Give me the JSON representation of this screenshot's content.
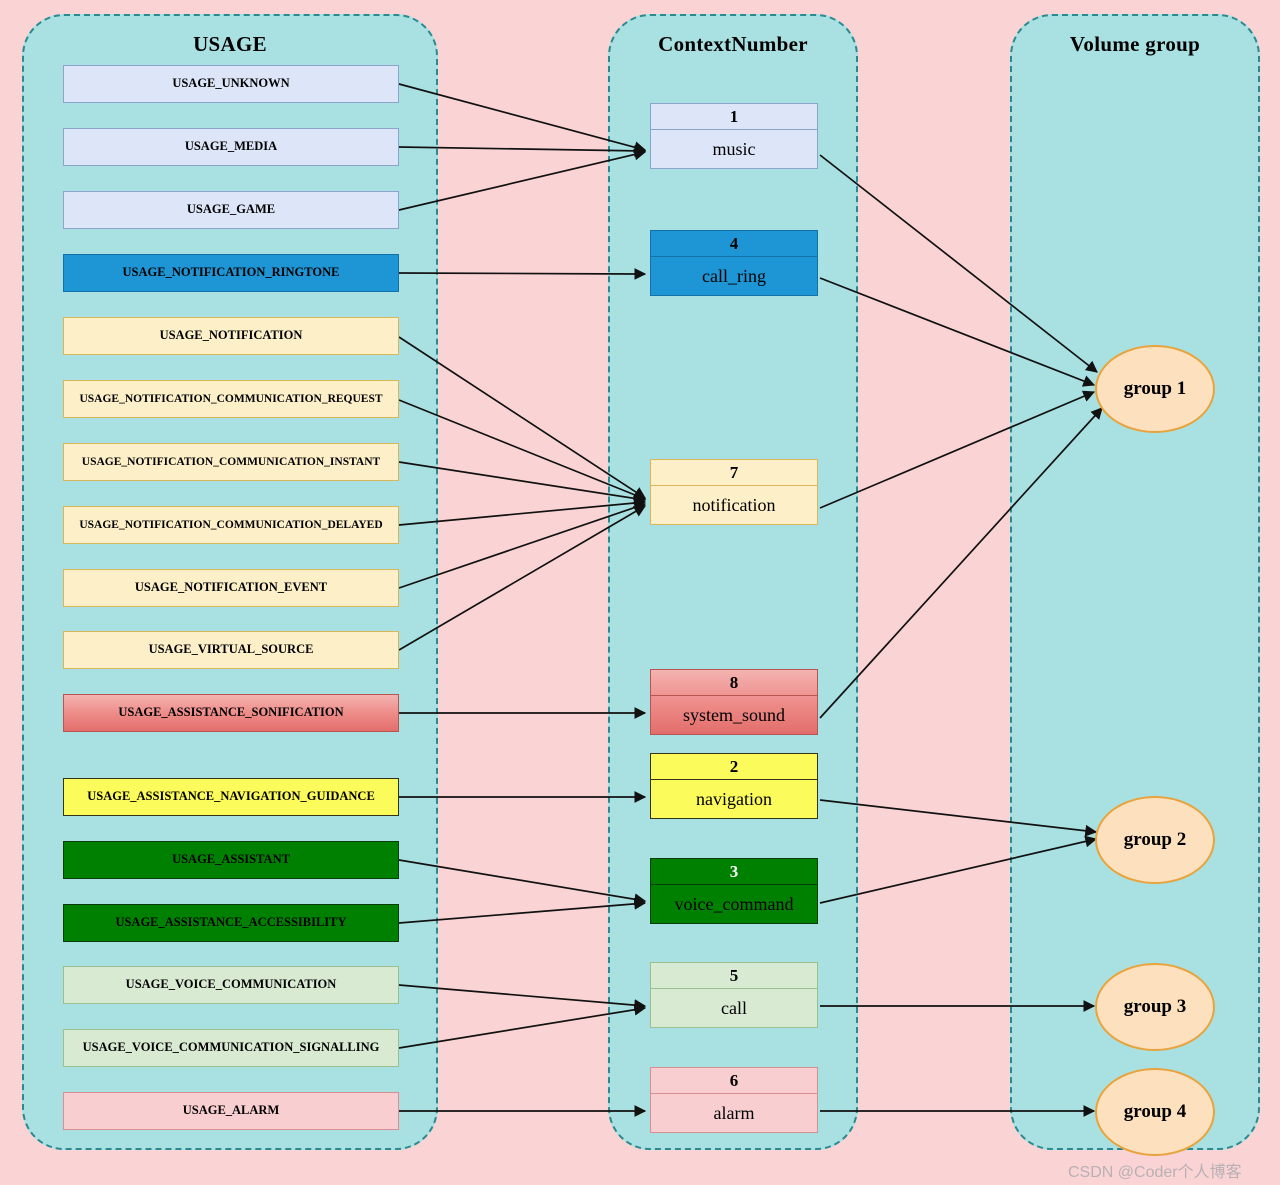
{
  "background_color": "#fad4d4",
  "panel_color": "#a9e1e3",
  "panel_border_color": "#2b8a8f",
  "columns": {
    "usage": {
      "title": "USAGE"
    },
    "context": {
      "title": "ContextNumber"
    },
    "volume": {
      "title": "Volume group"
    }
  },
  "usage_boxes": [
    {
      "label": "USAGE_UNKNOWN",
      "style": "u-blue",
      "color": "#dce6f8"
    },
    {
      "label": "USAGE_MEDIA",
      "style": "u-blue",
      "color": "#dce6f8"
    },
    {
      "label": "USAGE_GAME",
      "style": "u-blue",
      "color": "#dce6f8"
    },
    {
      "label": "USAGE_NOTIFICATION_RINGTONE",
      "style": "u-brightblue",
      "color": "#1e95d4"
    },
    {
      "label": "USAGE_NOTIFICATION",
      "style": "u-cream",
      "color": "#fdefc8"
    },
    {
      "label": "USAGE_NOTIFICATION_COMMUNICATION_REQUEST",
      "style": "u-cream",
      "color": "#fdefc8"
    },
    {
      "label": "USAGE_NOTIFICATION_COMMUNICATION_INSTANT",
      "style": "u-cream",
      "color": "#fdefc8"
    },
    {
      "label": "USAGE_NOTIFICATION_COMMUNICATION_DELAYED",
      "style": "u-cream",
      "color": "#fdefc8"
    },
    {
      "label": "USAGE_NOTIFICATION_EVENT",
      "style": "u-cream",
      "color": "#fdefc8"
    },
    {
      "label": "USAGE_VIRTUAL_SOURCE",
      "style": "u-cream",
      "color": "#fdefc8"
    },
    {
      "label": "USAGE_ASSISTANCE_SONIFICATION",
      "style": "u-redgrad",
      "color": "#ee8d8a"
    },
    {
      "label": "USAGE_ASSISTANCE_NAVIGATION_GUIDANCE",
      "style": "u-yellow",
      "color": "#fbfb5b"
    },
    {
      "label": "USAGE_ASSISTANT",
      "style": "u-green",
      "color": "#008000"
    },
    {
      "label": "USAGE_ASSISTANCE_ACCESSIBILITY",
      "style": "u-green",
      "color": "#008000"
    },
    {
      "label": "USAGE_VOICE_COMMUNICATION",
      "style": "u-paleg",
      "color": "#d9ead3"
    },
    {
      "label": "USAGE_VOICE_COMMUNICATION_SIGNALLING",
      "style": "u-paleg",
      "color": "#d9ead3"
    },
    {
      "label": "USAGE_ALARM",
      "style": "u-palepink",
      "color": "#f9ced0"
    }
  ],
  "context_boxes": [
    {
      "number": "1",
      "label": "music",
      "style": "c-blue",
      "color": "#dce6f8"
    },
    {
      "number": "4",
      "label": "call_ring",
      "style": "c-brightblue",
      "color": "#1e95d4"
    },
    {
      "number": "7",
      "label": "notification",
      "style": "c-cream",
      "color": "#fdefc8"
    },
    {
      "number": "8",
      "label": "system_sound",
      "style": "c-redgrad",
      "color": "#ee8d8a"
    },
    {
      "number": "2",
      "label": "navigation",
      "style": "c-yellow",
      "color": "#fbfb5b"
    },
    {
      "number": "3",
      "label": "voice_command",
      "style": "c-green",
      "color": "#008000"
    },
    {
      "number": "5",
      "label": "call",
      "style": "c-paleg",
      "color": "#d9ead3"
    },
    {
      "number": "6",
      "label": "alarm",
      "style": "c-palepink",
      "color": "#f9ced0"
    }
  ],
  "volume_groups": [
    {
      "label": "group 1",
      "color": "#fde0bd"
    },
    {
      "label": "group 2",
      "color": "#fde0bd"
    },
    {
      "label": "group 3",
      "color": "#fde0bd"
    },
    {
      "label": "group 4",
      "color": "#fde0bd"
    }
  ],
  "edges_usage_to_context": [
    {
      "from": "USAGE_UNKNOWN",
      "to": "music"
    },
    {
      "from": "USAGE_MEDIA",
      "to": "music"
    },
    {
      "from": "USAGE_GAME",
      "to": "music"
    },
    {
      "from": "USAGE_NOTIFICATION_RINGTONE",
      "to": "call_ring"
    },
    {
      "from": "USAGE_NOTIFICATION",
      "to": "notification"
    },
    {
      "from": "USAGE_NOTIFICATION_COMMUNICATION_REQUEST",
      "to": "notification"
    },
    {
      "from": "USAGE_NOTIFICATION_COMMUNICATION_INSTANT",
      "to": "notification"
    },
    {
      "from": "USAGE_NOTIFICATION_COMMUNICATION_DELAYED",
      "to": "notification"
    },
    {
      "from": "USAGE_NOTIFICATION_EVENT",
      "to": "notification"
    },
    {
      "from": "USAGE_VIRTUAL_SOURCE",
      "to": "notification"
    },
    {
      "from": "USAGE_ASSISTANCE_SONIFICATION",
      "to": "system_sound"
    },
    {
      "from": "USAGE_ASSISTANCE_NAVIGATION_GUIDANCE",
      "to": "navigation"
    },
    {
      "from": "USAGE_ASSISTANT",
      "to": "voice_command"
    },
    {
      "from": "USAGE_ASSISTANCE_ACCESSIBILITY",
      "to": "voice_command"
    },
    {
      "from": "USAGE_VOICE_COMMUNICATION",
      "to": "call"
    },
    {
      "from": "USAGE_VOICE_COMMUNICATION_SIGNALLING",
      "to": "call"
    },
    {
      "from": "USAGE_ALARM",
      "to": "alarm"
    }
  ],
  "edges_context_to_group": [
    {
      "from": "music",
      "to": "group 1"
    },
    {
      "from": "call_ring",
      "to": "group 1"
    },
    {
      "from": "notification",
      "to": "group 1"
    },
    {
      "from": "system_sound",
      "to": "group 1"
    },
    {
      "from": "navigation",
      "to": "group 2"
    },
    {
      "from": "voice_command",
      "to": "group 2"
    },
    {
      "from": "call",
      "to": "group 3"
    },
    {
      "from": "alarm",
      "to": "group 4"
    }
  ],
  "watermark": {
    "text": "CSDN @Coder个人博客"
  }
}
